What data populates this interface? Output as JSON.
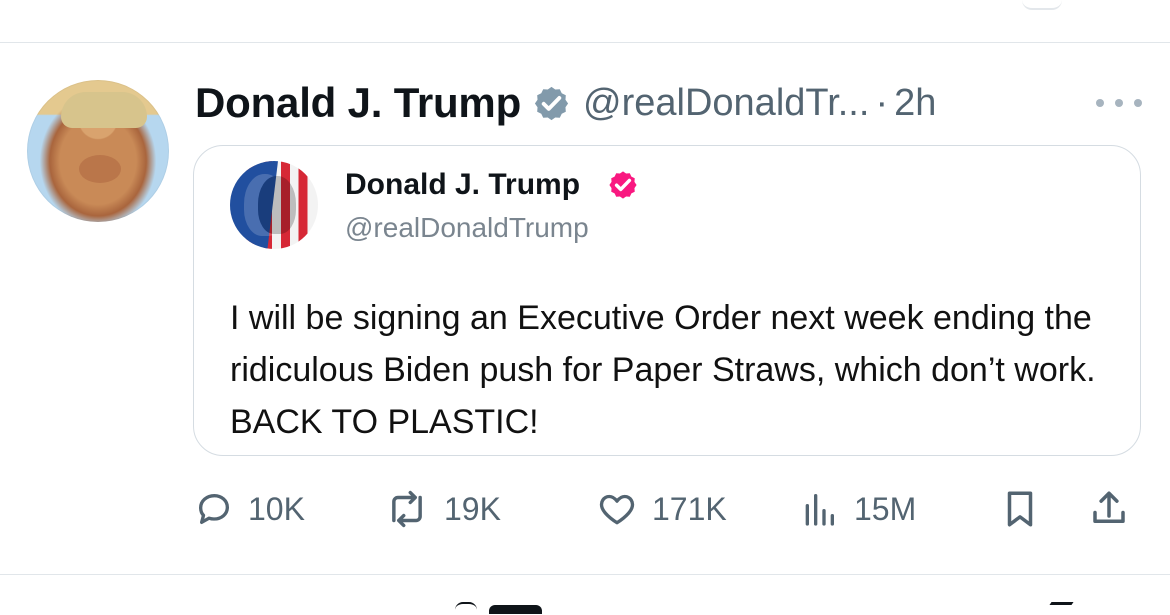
{
  "tweet": {
    "author": {
      "display_name": "Donald J. Trump",
      "handle": "@realDonaldTr...",
      "separator": "·",
      "timestamp": "2h"
    },
    "quoted_post": {
      "display_name": "Donald J. Trump",
      "handle": "@realDonaldTrump",
      "text": "I will be signing an Executive Order next week ending the ridiculous Biden push for Paper Straws, which don’t work. BACK TO PLASTIC!"
    },
    "actions": {
      "replies": "10K",
      "reposts": "19K",
      "likes": "171K",
      "views": "15M"
    }
  },
  "icons": {
    "verified": "verified-badge-icon",
    "quoted_verified": "verified-badge-icon",
    "more": "more-options-icon",
    "reply": "reply-icon",
    "repost": "repost-icon",
    "like": "heart-icon",
    "views": "analytics-icon",
    "bookmark": "bookmark-icon",
    "share": "share-icon"
  },
  "colors": {
    "text_primary": "#0f1419",
    "text_secondary": "#536471",
    "verified_blue": "#829aab",
    "quote_verified_pink": "#f91880",
    "divider": "#e1e6ea"
  }
}
